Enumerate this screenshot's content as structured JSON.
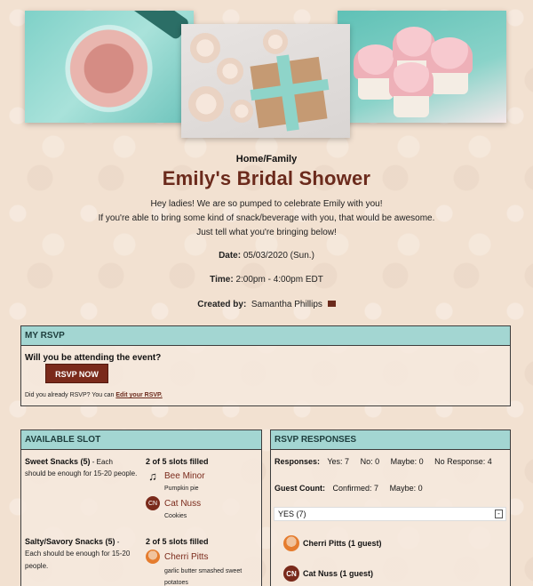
{
  "breadcrumb": "Home/Family",
  "title": "Emily's Bridal Shower",
  "description": [
    "Hey ladies! We are so pumped to celebrate Emily with you!",
    "If you're able to bring some kind of snack/beverage with you, that would be awesome.",
    "Just tell what you're bringing below!"
  ],
  "meta": {
    "date_label": "Date:",
    "date_value": "05/03/2020 (Sun.)",
    "time_label": "Time:",
    "time_value": "2:00pm - 4:00pm EDT",
    "created_label": "Created by:",
    "created_value": "Samantha Phillips"
  },
  "my_rsvp": {
    "header": "MY RSVP",
    "question": "Will you be attending the event?",
    "button": "RSVP NOW",
    "note": "Did you already RSVP? You can",
    "edit_link": "Edit your RSVP."
  },
  "slots": {
    "header": "AVAILABLE SLOT",
    "items": [
      {
        "name": "Sweet Snacks (5)",
        "desc_inline": " - Each",
        "desc_rest": "should be enough for 15-20 people.",
        "filled": "2 of 5 slots filled",
        "people": [
          {
            "avatar": "music",
            "name": "Bee Minor",
            "item": "Pumpkin pie"
          },
          {
            "avatar": "CN",
            "name": "Cat Nuss",
            "item": "Cookies"
          }
        ]
      },
      {
        "name": "Salty/Savory Snacks (5)",
        "desc_inline": " -",
        "desc_rest": "Each should be enough for 15-20 people.",
        "filled": "2 of 5 slots filled",
        "people": [
          {
            "avatar": "photo",
            "name": "Cherri Pitts",
            "item": "garlic butter smashed sweet potatoes"
          }
        ]
      }
    ]
  },
  "responses": {
    "header": "RSVP RESPONSES",
    "responses_label": "Responses:",
    "yes": "Yes: 7",
    "no": "No: 0",
    "maybe": "Maybe: 0",
    "no_response": "No Response: 4",
    "guest_label": "Guest Count:",
    "confirmed": "Confirmed: 7",
    "guest_maybe": "Maybe: 0",
    "yes_section": "YES (7)",
    "collapse": "-",
    "guests": [
      {
        "avatar": "photo",
        "name": "Cherri Pitts (1 guest)"
      },
      {
        "avatar": "CN",
        "name": "Cat Nuss (1 guest)"
      }
    ]
  },
  "colors": {
    "accent": "#6b2a1c",
    "panel_header": "#a3d6d2",
    "button": "#7a2a1b"
  }
}
